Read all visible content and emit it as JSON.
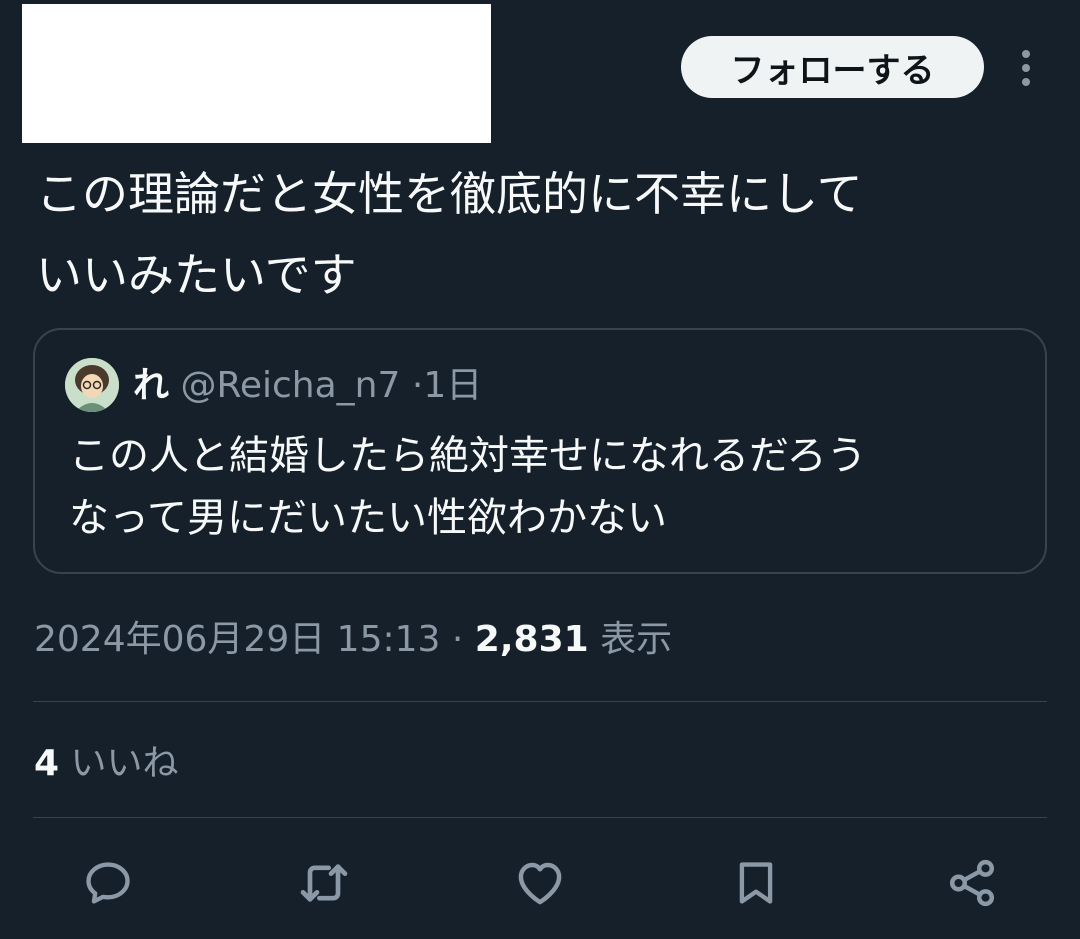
{
  "header": {
    "follow_label": "フォローする"
  },
  "tweet": {
    "text": "この理論だと女性を徹底的に不幸にして\nいいみたいです"
  },
  "quote": {
    "name": "れ",
    "handle": "@Reicha_n7",
    "separator": "·",
    "time": "1日",
    "text": "この人と結婚したら絶対幸せになれるだろう\nなって男にだいたい性欲わかない"
  },
  "meta": {
    "timestamp": "2024年06月29日 15:13",
    "separator": "·",
    "views_count": "2,831",
    "views_label": "表示"
  },
  "stats": {
    "likes_count": "4",
    "likes_label": "いいね"
  },
  "actions": {
    "reply_icon": "reply-icon",
    "retweet_icon": "retweet-icon",
    "like_icon": "heart-icon",
    "bookmark_icon": "bookmark-icon",
    "share_icon": "share-icon"
  },
  "colors": {
    "background": "#15202b",
    "text": "#f7f9f9",
    "secondary_text": "#8b98a5",
    "border": "#38444d",
    "follow_button": "#eff3f4"
  }
}
